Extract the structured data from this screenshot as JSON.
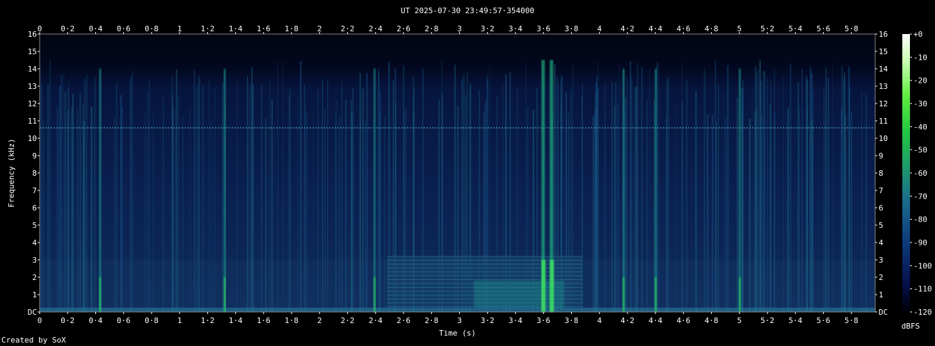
{
  "chart_data": {
    "type": "heatmap",
    "title": "UT 2025-07-30 23:49:57·354000",
    "xlabel": "Time (s)",
    "ylabel": "Frequency (kHz)",
    "xlim": [
      0,
      5.97
    ],
    "ylim": [
      0,
      16
    ],
    "x_ticks": [
      "0",
      "0·2",
      "0·4",
      "0·6",
      "0·8",
      "1",
      "1·2",
      "1·4",
      "1·6",
      "1·8",
      "2",
      "2·2",
      "2·4",
      "2·6",
      "2·8",
      "3",
      "3·2",
      "3·4",
      "3·6",
      "3·8",
      "4",
      "4·2",
      "4·4",
      "4·6",
      "4·8",
      "5",
      "5·2",
      "5·4",
      "5·6",
      "5·8"
    ],
    "y_ticks": [
      "DC",
      "1",
      "2",
      "3",
      "4",
      "5",
      "6",
      "7",
      "8",
      "9",
      "10",
      "11",
      "12",
      "13",
      "14",
      "15",
      "16"
    ],
    "colorbar": {
      "label": "dBFS",
      "ticks": [
        "+0",
        "-10",
        "-20",
        "-30",
        "-40",
        "-50",
        "-60",
        "-70",
        "-80",
        "-90",
        "-100",
        "-110",
        "-120"
      ],
      "range": [
        -120,
        0
      ]
    },
    "features": {
      "tone_kHz": 10.6,
      "bursts_s": [
        0.43,
        1.32,
        2.39,
        3.59,
        3.65,
        4.17,
        4.4,
        5.0
      ],
      "band_region_s": [
        2.48,
        3.88
      ],
      "band_region_kHz": [
        0.3,
        3.2
      ],
      "noise_ceiling_kHz": 14.2
    },
    "credit": "Created by SoX"
  }
}
